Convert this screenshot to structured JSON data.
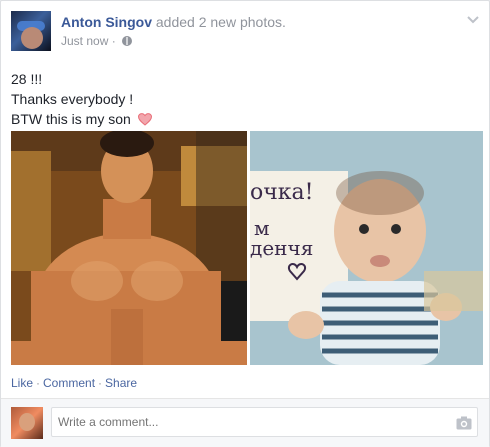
{
  "post": {
    "author": "Anton Singov",
    "action": "added 2 new photos.",
    "timestamp": "Just now",
    "separator": "·",
    "text_lines": [
      "28 !!!",
      "Thanks everybody !",
      "BTW this is my son"
    ]
  },
  "photos": [
    {
      "description_icon": "photo-muscular-man"
    },
    {
      "description_icon": "photo-baby-with-sign",
      "sign_text": [
        "очка!",
        "м",
        "денчя"
      ]
    }
  ],
  "actions": {
    "like": "Like",
    "comment": "Comment",
    "share": "Share",
    "sep": "·"
  },
  "comment_box": {
    "placeholder": "Write a comment..."
  },
  "colors": {
    "name": "#3b5998",
    "link": "#4b67a1",
    "muted": "#90949c",
    "heart": "#e9707a"
  }
}
